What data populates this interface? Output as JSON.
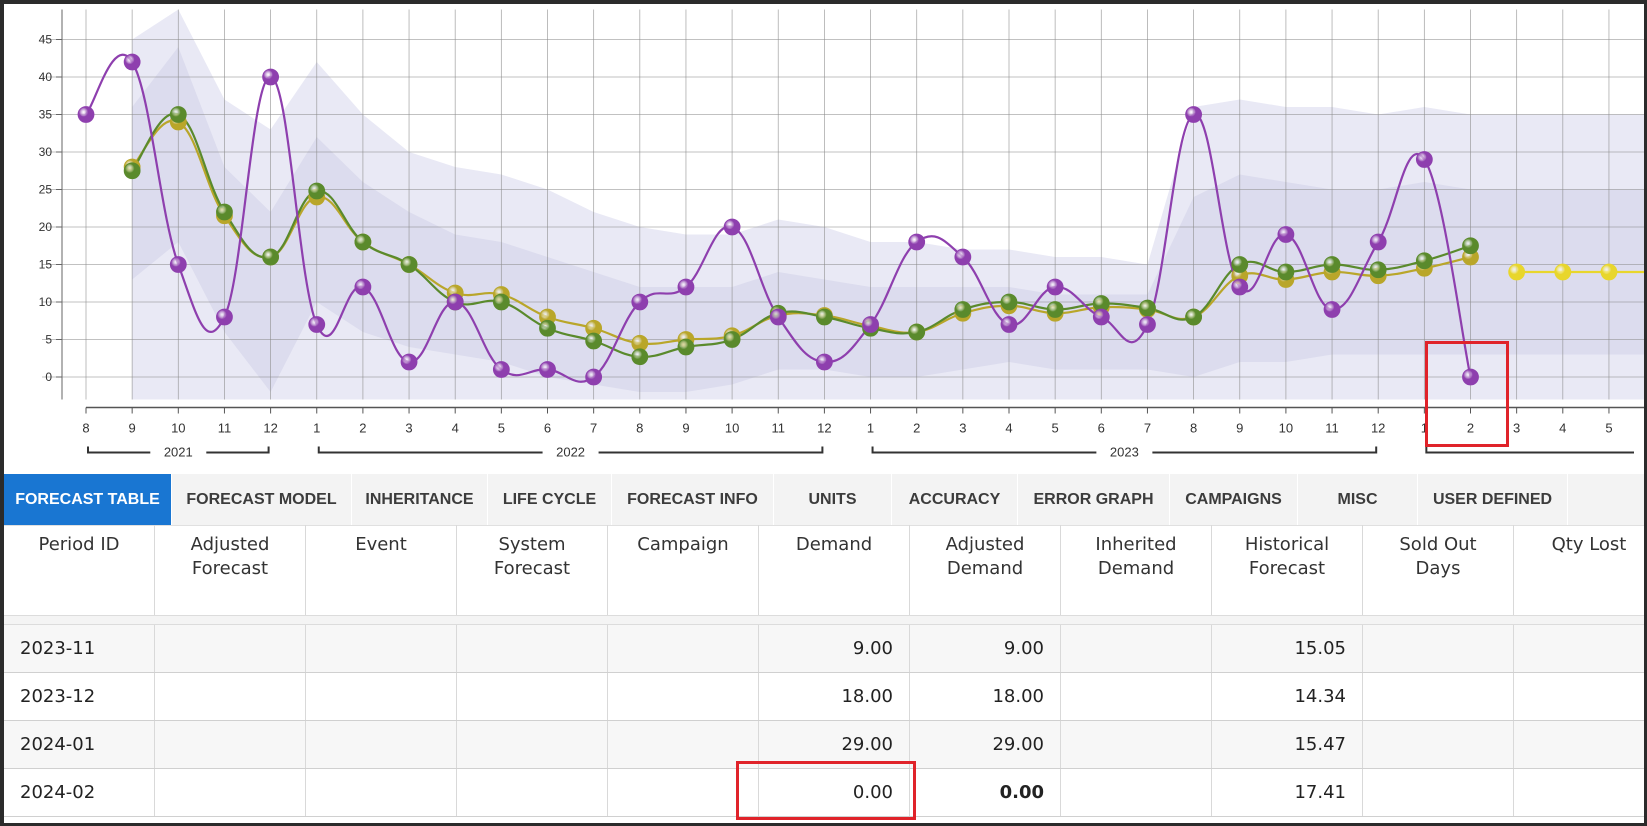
{
  "chart_data": {
    "type": "line",
    "y_ticks": [
      "0",
      "5",
      "10",
      "15",
      "20",
      "25",
      "30",
      "35",
      "40",
      "45"
    ],
    "ylim": [
      -3,
      49
    ],
    "x_ticks": [
      "8",
      "9",
      "10",
      "11",
      "12",
      "1",
      "2",
      "3",
      "4",
      "5",
      "6",
      "7",
      "8",
      "9",
      "10",
      "11",
      "12",
      "1",
      "2",
      "3",
      "4",
      "5",
      "6",
      "7",
      "8",
      "9",
      "10",
      "11",
      "12",
      "1",
      "2",
      "3",
      "4",
      "5"
    ],
    "years": [
      "2021",
      "2022",
      "2023"
    ],
    "grid": true,
    "series": [
      {
        "color": "#8e3fae",
        "values": [
          35,
          42,
          15,
          8,
          40,
          7,
          12,
          2,
          10,
          1,
          1,
          0,
          10,
          12,
          20,
          8,
          2,
          7,
          18,
          16,
          7,
          12,
          8,
          7,
          35,
          12,
          19,
          9,
          18,
          29,
          0
        ]
      },
      {
        "color": "#5a8a2c",
        "values": [
          null,
          27.5,
          35,
          22,
          16,
          24.8,
          18,
          15,
          10,
          10,
          6.5,
          4.8,
          2.7,
          4,
          5,
          8.5,
          8,
          6.5,
          6,
          9,
          10,
          9,
          9.8,
          9.2,
          8,
          15,
          14,
          15,
          14.3,
          15.5,
          17.5
        ]
      },
      {
        "color": "#b9a62a",
        "values": [
          null,
          28,
          34,
          21.5,
          16,
          24,
          18,
          15,
          11.2,
          11,
          8,
          6.5,
          4.5,
          5,
          5.5,
          8.2,
          8.2,
          6.8,
          6,
          8.5,
          9.5,
          8.5,
          9.3,
          9,
          8,
          13.5,
          13,
          14,
          13.5,
          14.5,
          16
        ]
      },
      {
        "color": "#e8d62c",
        "values": [
          null,
          null,
          null,
          null,
          null,
          null,
          null,
          null,
          null,
          null,
          null,
          null,
          null,
          null,
          null,
          null,
          null,
          null,
          null,
          null,
          null,
          null,
          null,
          null,
          null,
          null,
          null,
          null,
          null,
          null,
          null,
          14,
          14,
          14,
          14
        ]
      }
    ],
    "band_outer_upper": [
      null,
      45,
      49,
      37,
      33,
      42,
      35,
      30,
      28,
      27,
      25,
      22,
      20,
      19,
      19,
      21,
      20,
      18,
      18,
      17,
      17,
      16,
      16,
      15,
      36,
      37,
      36,
      36,
      35,
      36,
      35,
      35,
      35,
      35,
      35
    ],
    "band_outer_lower": [
      null,
      -3,
      -3,
      -3,
      -3,
      -3,
      -3,
      -3,
      -3,
      -3,
      -3,
      -3,
      -3,
      -3,
      -3,
      -3,
      -3,
      -3,
      -3,
      -3,
      -3,
      -3,
      -3,
      -3,
      -3,
      -3,
      -3,
      -3,
      -3,
      -3,
      -3,
      -3,
      -3,
      -3,
      -3
    ],
    "band_inner_upper": [
      null,
      36,
      44,
      28,
      22,
      32,
      26,
      22,
      19,
      18,
      16,
      14,
      12,
      12,
      12,
      14,
      13,
      12,
      12,
      12,
      12,
      11,
      11,
      11,
      24,
      27,
      26,
      25,
      25,
      26,
      25,
      25,
      25,
      25,
      25
    ],
    "band_inner_lower": [
      null,
      13,
      18,
      6,
      -2,
      10,
      6,
      4,
      3,
      2,
      0,
      -1,
      -2,
      -2,
      -1,
      1,
      1,
      0,
      0,
      1,
      2,
      1,
      1,
      1,
      0,
      2,
      2,
      3,
      3,
      3,
      3,
      3,
      3,
      3,
      3
    ]
  },
  "tabs": [
    "FORECAST TABLE",
    "FORECAST MODEL",
    "INHERITANCE",
    "LIFE CYCLE",
    "FORECAST INFO",
    "UNITS",
    "ACCURACY",
    "ERROR GRAPH",
    "CAMPAIGNS",
    "MISC",
    "USER DEFINED"
  ],
  "table": {
    "headers": [
      "Period ID",
      "Adjusted\nForecast",
      "Event",
      "System\nForecast",
      "Campaign",
      "Demand",
      "Adjusted\nDemand",
      "Inherited\nDemand",
      "Historical\nForecast",
      "Sold Out\nDays",
      "Qty Lost"
    ],
    "rows": [
      {
        "period": "2023-11",
        "demand": "9.00",
        "adjusted_demand": "9.00",
        "historical_forecast": "15.05"
      },
      {
        "period": "2023-12",
        "demand": "18.00",
        "adjusted_demand": "18.00",
        "historical_forecast": "14.34"
      },
      {
        "period": "2024-01",
        "demand": "29.00",
        "adjusted_demand": "29.00",
        "historical_forecast": "15.47"
      },
      {
        "period": "2024-02",
        "demand": "0.00",
        "adjusted_demand": "0.00",
        "historical_forecast": "17.41"
      }
    ]
  },
  "colors": {
    "active_tab": "#1976d2",
    "highlight": "#e0232a"
  }
}
